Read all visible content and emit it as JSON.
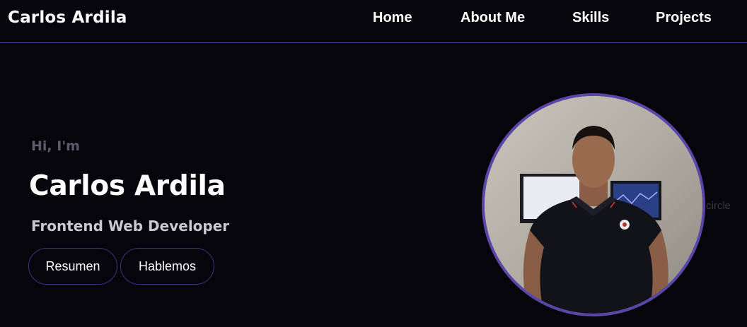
{
  "header": {
    "brand": "Carlos Ardila",
    "nav": {
      "home": "Home",
      "about": "About Me",
      "skills": "Skills",
      "projects": "Projects"
    }
  },
  "hero": {
    "greeting": "Hi, I'm",
    "name": "Carlos Ardila",
    "role": "Frontend Web Developer",
    "buttons": {
      "resume": "Resumen",
      "talk": "Hablemos"
    },
    "stray_text": "circle",
    "photo_alt": "Carlos Ardila"
  },
  "colors": {
    "background": "#06050b",
    "accent": "#5a45a8",
    "nav_border": "#4b3f8f",
    "button_border": "#3d3480",
    "greeting": "#5b5d6b",
    "role": "#c9c9d0"
  }
}
